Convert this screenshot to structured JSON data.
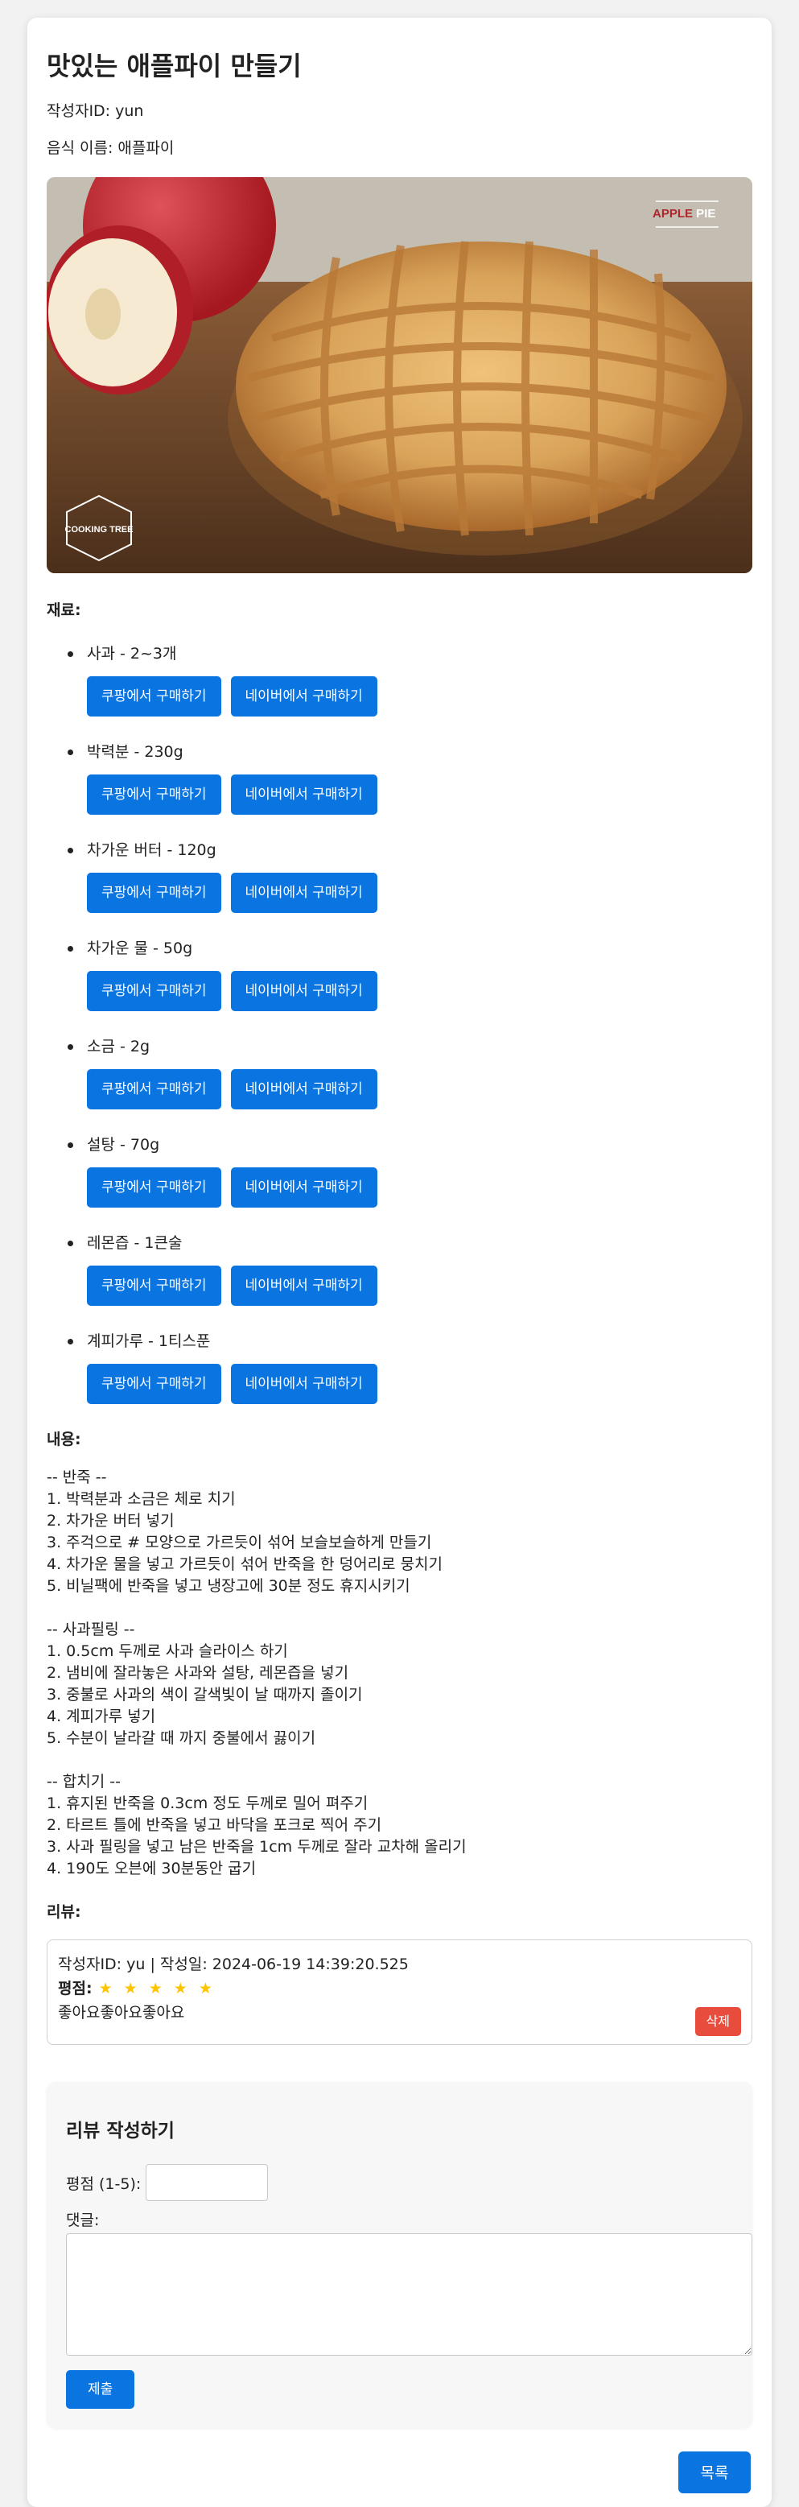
{
  "page": {
    "title": "맛있는 애플파이 만들기",
    "author_line": "작성자ID: yun",
    "food_line": "음식 이름: 애플파이"
  },
  "hero": {
    "brand_apple": "APPLE",
    "brand_pie": " PIE",
    "logo_text": "COOKING TREE",
    "colors": {
      "wood": "#6b4a2e",
      "crust": "#d9a35a",
      "apple_red": "#c8242c"
    }
  },
  "ingredients_label": "재료:",
  "ingredients": [
    {
      "name": "사과 - 2~3개"
    },
    {
      "name": "박력분 - 230g"
    },
    {
      "name": "차가운 버터 - 120g"
    },
    {
      "name": "차가운 물 - 50g"
    },
    {
      "name": "소금 - 2g"
    },
    {
      "name": "설탕 - 70g"
    },
    {
      "name": "레몬즙 - 1큰술"
    },
    {
      "name": "계피가루 - 1티스푼"
    }
  ],
  "buy_buttons": {
    "coupang": "쿠팡에서 구매하기",
    "naver": "네이버에서 구매하기"
  },
  "content_label": "내용:",
  "content": "-- 반죽 --\n1. 박력분과 소금은 체로 치기\n2. 차가운 버터 넣기\n3. 주걱으로 # 모양으로 가르듯이 섞어 보슬보슬하게 만들기\n4. 차가운 물을 넣고 가르듯이 섞어 반죽을 한 덩어리로 뭉치기\n5. 비닐팩에 반죽을 넣고 냉장고에 30분 정도 휴지시키기\n\n-- 사과필링 --\n1. 0.5cm 두께로 사과 슬라이스 하기\n2. 냄비에 잘라놓은 사과와 설탕, 레몬즙을 넣기\n3. 중불로 사과의 색이 갈색빛이 날 때까지 졸이기\n4. 계피가루 넣기\n5. 수분이 날라갈 때 까지 중불에서 끓이기\n\n-- 합치기 --\n1. 휴지된 반죽을 0.3cm 정도 두께로 밀어 펴주기\n2. 타르트 틀에 반죽을 넣고 바닥을 포크로 찍어 주기\n3. 사과 필링을 넣고 남은 반죽을 1cm 두께로 잘라 교차해 올리기\n4. 190도 오븐에 30분동안 굽기",
  "reviews_label": "리뷰:",
  "reviews": [
    {
      "meta": "작성자ID: yu | 작성일: 2024-06-19 14:39:20.525",
      "rating_label": "평점:",
      "rating": 5,
      "stars": "★ ★ ★ ★ ★",
      "text": "좋아요좋아요좋아요",
      "delete_label": "삭제"
    }
  ],
  "review_form": {
    "title": "리뷰 작성하기",
    "rating_label": "평점 (1-5):",
    "rating_value": "",
    "comment_label": "댓글:",
    "comment_value": "",
    "submit_label": "제출"
  },
  "list_button": "목록"
}
